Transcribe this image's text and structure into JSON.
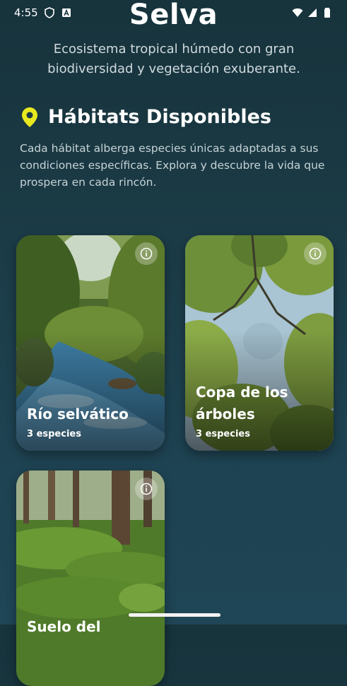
{
  "status_bar": {
    "time": "4:55",
    "left_icons": [
      "shield-icon",
      "app-notification-icon"
    ],
    "right_icons": [
      "wifi-icon",
      "signal-icon",
      "battery-icon"
    ]
  },
  "header": {
    "title": "Selva",
    "subtitle": "Ecosistema tropical húmedo con gran biodiversidad y vegetación exuberante."
  },
  "section": {
    "icon": "location-pin-icon",
    "title": "Hábitats Disponibles",
    "description": "Cada hábitat alberga especies únicas adaptadas a sus condiciones específicas. Explora y descubre la vida que prospera en cada rincón."
  },
  "habitats": [
    {
      "name": "Río selvático",
      "count": "3 especies",
      "icon": "info-icon"
    },
    {
      "name": "Copa de los árboles",
      "count": "3 especies",
      "icon": "info-icon"
    },
    {
      "name": "Suelo del",
      "count": "",
      "icon": "info-icon"
    }
  ],
  "colors": {
    "accent": "#e8e81f",
    "background_top": "#17333c",
    "background_bottom": "#1f4656"
  }
}
